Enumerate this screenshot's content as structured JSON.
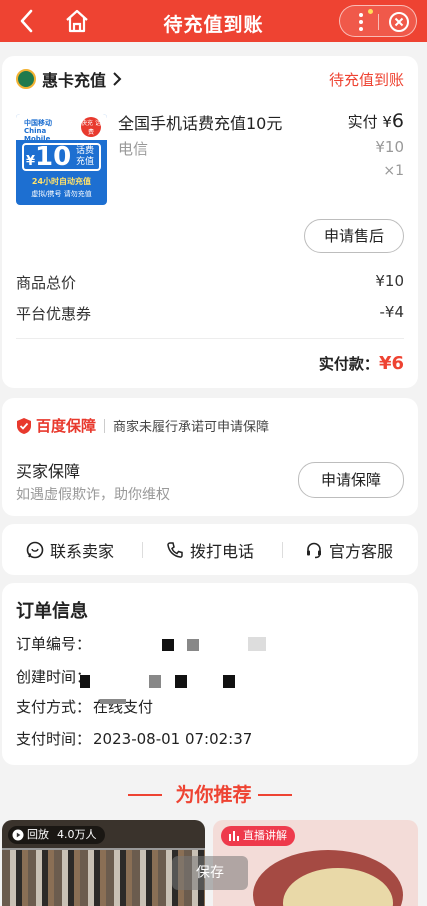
{
  "header": {
    "title": "待充值到账",
    "accent": "#ee4332"
  },
  "shop": {
    "name": "惠卡充值",
    "status": "待充值到账"
  },
  "product": {
    "name": "全国手机话费充值10元",
    "spec": "电信",
    "paid_label": "实付",
    "paid_currency": "¥",
    "paid_amount": "6",
    "original_price": "¥10",
    "quantity": "×1",
    "image": {
      "brand": "中国移动 China Mobile",
      "tag": "快充 话费",
      "currency": "¥",
      "value": "10",
      "value_text": "话费充值",
      "auto": "24小时自动充值",
      "note": "虚拟/携号  请勿充值"
    }
  },
  "after_sale_button": "申请售后",
  "summary": {
    "total_label": "商品总价",
    "total_value": "¥10",
    "coupon_label": "平台优惠券",
    "coupon_value": "-¥4",
    "paid_label": "实付款：",
    "paid_value": "¥6"
  },
  "guarantee": {
    "brand": "百度保障",
    "desc": "商家未履行承诺可申请保障",
    "buyer_title": "买家保障",
    "buyer_sub": "如遇虚假欺诈，助你维权",
    "apply_button": "申请保障"
  },
  "contact": {
    "seller": "联系卖家",
    "phone": "拨打电话",
    "service": "官方客服"
  },
  "order_info": {
    "title": "订单信息",
    "number_label": "订单编号：",
    "created_label": "创建时间：",
    "pay_method_label": "支付方式：",
    "pay_method_value": "在线支付",
    "pay_time_label": "支付时间：",
    "pay_time_value": "2023-08-01 07:02:37"
  },
  "recommend": {
    "title": "为你推荐"
  },
  "feed": [
    {
      "badge": "回放",
      "views": "4.0万人"
    },
    {
      "badge": "直播讲解"
    }
  ],
  "save_button": "保存"
}
